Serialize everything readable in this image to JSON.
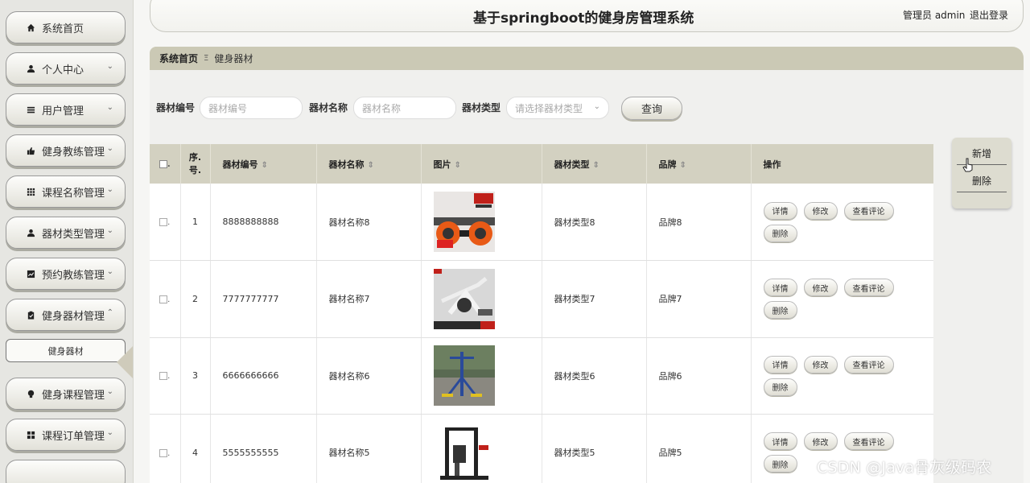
{
  "sidebar": {
    "items": [
      {
        "label": "系统首页",
        "icon": "home-icon",
        "chevron": ""
      },
      {
        "label": "个人中心",
        "icon": "user-icon",
        "chevron": "⌄"
      },
      {
        "label": "用户管理",
        "icon": "list-icon",
        "chevron": "⌄"
      },
      {
        "label": "健身教练管理",
        "icon": "thumb-up-icon",
        "chevron": "⌄"
      },
      {
        "label": "课程名称管理",
        "icon": "grid-icon",
        "chevron": "⌄"
      },
      {
        "label": "器材类型管理",
        "icon": "user-icon",
        "chevron": "⌄"
      },
      {
        "label": "预约教练管理",
        "icon": "chart-icon",
        "chevron": "⌄"
      },
      {
        "label": "健身器材管理",
        "icon": "clipboard-icon",
        "chevron": "⌃"
      },
      {
        "label": "健身课程管理",
        "icon": "bulb-icon",
        "chevron": "⌄"
      },
      {
        "label": "课程订单管理",
        "icon": "apps-icon",
        "chevron": "⌄"
      }
    ],
    "active_sub": "健身器材"
  },
  "header": {
    "title": "基于springboot的健身房管理系统",
    "admin_label": "管理员 admin",
    "logout_label": "退出登录"
  },
  "breadcrumb": {
    "home": "系统首页",
    "separator": "Ξ",
    "current": "健身器材"
  },
  "search": {
    "code_label": "器材编号",
    "code_placeholder": "器材编号",
    "name_label": "器材名称",
    "name_placeholder": "器材名称",
    "type_label": "器材类型",
    "type_placeholder": "请选择器材类型",
    "query_label": "查询"
  },
  "actions": {
    "add_label": "新增",
    "delete_label": "删除"
  },
  "table": {
    "headers": [
      "序号",
      "器材编号",
      "器材名称",
      "图片",
      "器材类型",
      "品牌",
      "操作"
    ],
    "header_index_line1": "序.",
    "header_index_line2": "号.",
    "sort_glyph": "⇕",
    "rows": [
      {
        "no": "1",
        "code": "8888888888",
        "name": "器材名称8",
        "type": "器材类型8",
        "brand": "品牌8",
        "image": "ab-roller-image"
      },
      {
        "no": "2",
        "code": "7777777777",
        "name": "器材名称7",
        "type": "器材类型7",
        "brand": "品牌7",
        "image": "spin-bike-image"
      },
      {
        "no": "3",
        "code": "6666666666",
        "name": "器材名称6",
        "type": "器材类型6",
        "brand": "品牌6",
        "image": "outdoor-walker-image"
      },
      {
        "no": "4",
        "code": "5555555555",
        "name": "器材名称5",
        "type": "器材类型5",
        "brand": "品牌5",
        "image": "multi-gym-image"
      }
    ],
    "op_labels": {
      "detail": "详情",
      "edit": "修改",
      "comments": "查看评论",
      "delete": "删除"
    }
  },
  "watermark": "CSDN @Java骨灰级码农",
  "colors": {
    "accent": "#cbc9b5",
    "table_header": "#d3d1c1",
    "button_shadow": "#b5b3a5"
  }
}
